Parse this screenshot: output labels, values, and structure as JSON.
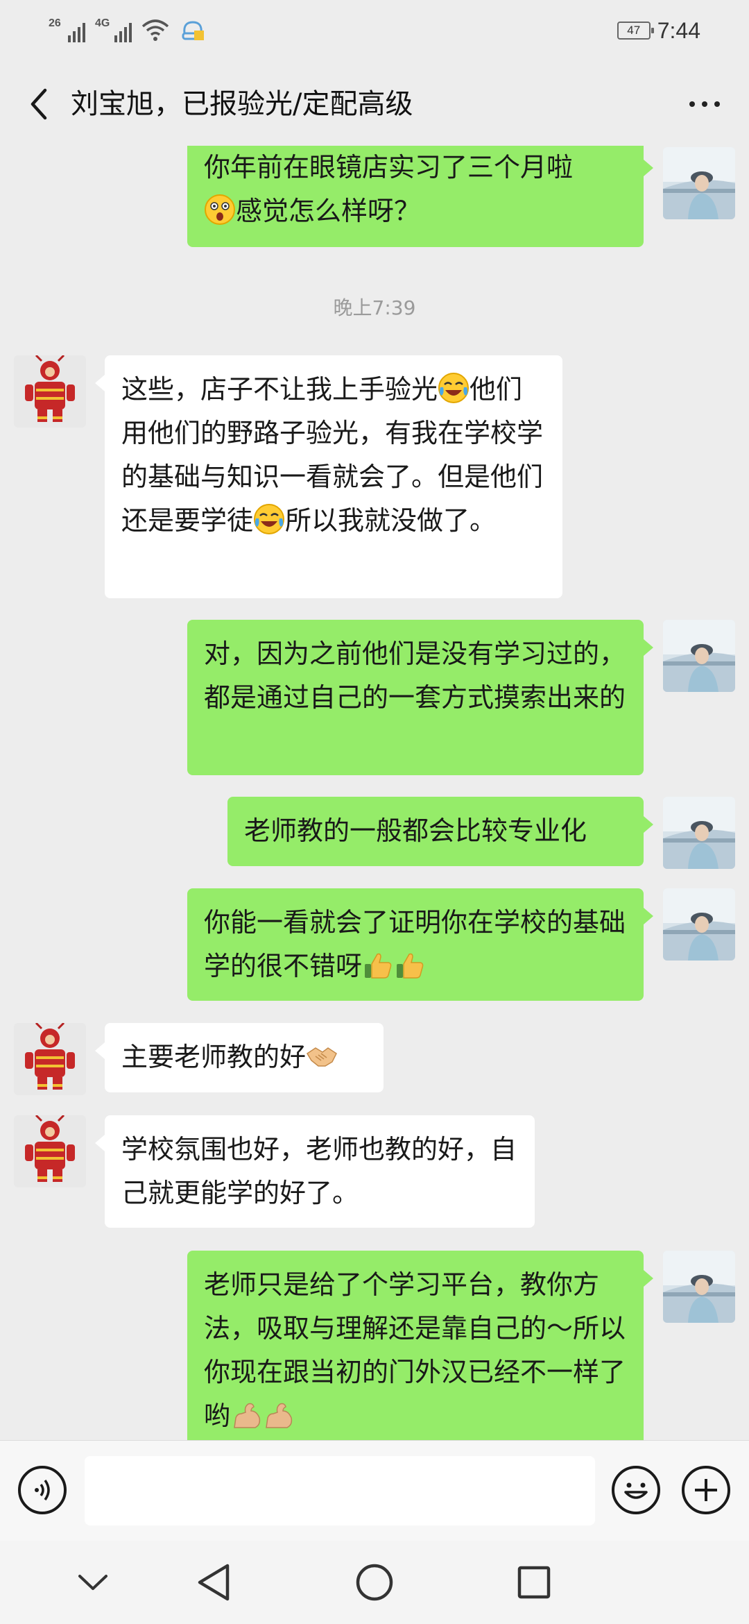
{
  "status_bar": {
    "signal1_label": "26",
    "signal2_label": "4G",
    "battery": "47",
    "time": "7:44"
  },
  "header": {
    "title": "刘宝旭，已报验光/定配高级",
    "back_icon": "chevron-left-icon",
    "more_icon": "more-dots-icon"
  },
  "chat": {
    "timestamp": "晚上7:39",
    "messages": [
      {
        "from": "me",
        "text_a": "你年前在眼镜店实习了三个月啦",
        "emoji_a": "astonished-face-emoji",
        "text_b": "感觉怎么样呀？"
      },
      {
        "from": "other",
        "text_a": "这些，店子不让我上手验光",
        "emoji_a": "tears-of-joy-emoji",
        "text_b": "他们用他们的野路子验光，有我在学校学的基础与知识一看就会了。但是他们还是要学徒",
        "emoji_b": "tears-of-joy-emoji",
        "text_c": "所以我就没做了。"
      },
      {
        "from": "me",
        "text": "对，因为之前他们是没有学习过的，都是通过自己的一套方式摸索出来的"
      },
      {
        "from": "me",
        "text": "老师教的一般都会比较专业化"
      },
      {
        "from": "me",
        "text_a": "你能一看就会了证明你在学校的基础学的很不错呀",
        "emoji_a": "thumbs-up-emoji",
        "emoji_b": "thumbs-up-emoji"
      },
      {
        "from": "other",
        "text_a": "主要老师教的好",
        "emoji_a": "handshake-emoji"
      },
      {
        "from": "other",
        "text": "学校氛围也好，老师也教的好，自己就更能学的好了。"
      },
      {
        "from": "me",
        "text_a": "老师只是给了个学习平台，教你方法，吸取与理解还是靠自己的～所以你现在跟当初的门外汉已经不一样了哟",
        "emoji_a": "flexed-biceps-emoji",
        "emoji_b": "flexed-biceps-emoji"
      }
    ]
  },
  "input_bar": {
    "voice_icon": "voice-icon",
    "input_value": "",
    "emoji_icon": "smiley-icon",
    "plus_icon": "plus-icon"
  },
  "nav_bar": {
    "icons": [
      "chevron-down-icon",
      "back-triangle-icon",
      "home-circle-icon",
      "recents-square-icon"
    ]
  },
  "colors": {
    "background": "#ededed",
    "my_bubble": "#95ec69",
    "their_bubble": "#ffffff",
    "timestamp_text": "#9a9a9a"
  }
}
